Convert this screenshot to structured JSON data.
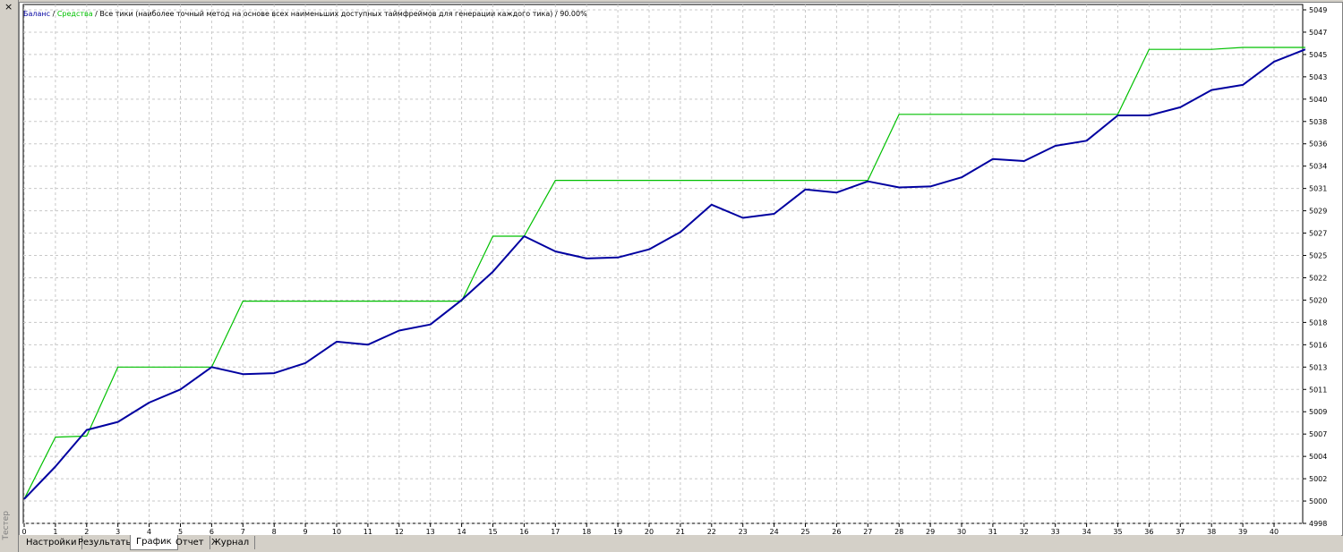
{
  "window": {
    "side_label": "Тестер",
    "close_glyph": "×"
  },
  "legend": {
    "balance_label": "Баланс",
    "equity_label": "Средства",
    "separator": " / ",
    "method_text": "Все тики (наиболее точный метод на основе всех наименьших доступных таймфреймов для генерации каждого тика)",
    "quality_text": "90.00%"
  },
  "tabs": [
    {
      "label": "Настройки",
      "active": false
    },
    {
      "label": "Результаты",
      "active": false
    },
    {
      "label": "График",
      "active": true
    },
    {
      "label": "Отчет",
      "active": false
    },
    {
      "label": "Журнал",
      "active": false
    }
  ],
  "colors": {
    "balance": "#0000a0",
    "equity": "#00c000",
    "grid": "#c8c8c8",
    "text": "#000000"
  },
  "chart_data": {
    "type": "line",
    "xlabel": "",
    "ylabel": "",
    "grid": true,
    "xlim": [
      0,
      41
    ],
    "ylim": [
      4998,
      5049
    ],
    "x_ticks": [
      0,
      1,
      2,
      3,
      4,
      5,
      6,
      7,
      8,
      9,
      10,
      11,
      12,
      13,
      14,
      15,
      16,
      17,
      18,
      19,
      20,
      21,
      22,
      23,
      24,
      25,
      26,
      27,
      28,
      29,
      30,
      31,
      32,
      33,
      34,
      35,
      36,
      37,
      38,
      39,
      40
    ],
    "y_ticks": [
      {
        "label": "5049",
        "value": 5049
      },
      {
        "label": "5047",
        "value": 5047
      },
      {
        "label": "5045",
        "value": 5045
      },
      {
        "label": "5043",
        "value": 5043
      },
      {
        "label": "5040",
        "value": 5040
      },
      {
        "label": "5038",
        "value": 5038
      },
      {
        "label": "5036",
        "value": 5036
      },
      {
        "label": "5034",
        "value": 5034
      },
      {
        "label": "5031",
        "value": 5031
      },
      {
        "label": "5029",
        "value": 5029
      },
      {
        "label": "5027",
        "value": 5027
      },
      {
        "label": "5025",
        "value": 5025
      },
      {
        "label": "5022",
        "value": 5022
      },
      {
        "label": "5020",
        "value": 5020
      },
      {
        "label": "5018",
        "value": 5018
      },
      {
        "label": "5016",
        "value": 5016
      },
      {
        "label": "5013",
        "value": 5013
      },
      {
        "label": "5011",
        "value": 5011
      },
      {
        "label": "5009",
        "value": 5009
      },
      {
        "label": "5007",
        "value": 5007
      },
      {
        "label": "5004",
        "value": 5004
      },
      {
        "label": "5002",
        "value": 5002
      },
      {
        "label": "5000",
        "value": 5000
      },
      {
        "label": "4998",
        "value": 4998
      }
    ],
    "series": [
      {
        "name": "Баланс",
        "x": [
          0,
          1,
          2,
          3,
          4,
          5,
          6,
          7,
          8,
          9,
          10,
          11,
          12,
          13,
          14,
          15,
          16,
          17,
          18,
          19,
          20,
          21,
          22,
          23,
          24,
          25,
          26,
          27,
          28,
          29,
          30,
          31,
          32,
          33,
          34,
          35,
          36,
          37,
          38,
          39,
          40,
          41
        ],
        "values": [
          5000,
          5003.2,
          5006.8,
          5007.6,
          5009.5,
          5010.8,
          5013.0,
          5012.3,
          5012.4,
          5013.4,
          5015.5,
          5015.2,
          5016.6,
          5017.2,
          5019.6,
          5022.4,
          5025.9,
          5024.4,
          5023.7,
          5023.8,
          5024.6,
          5026.3,
          5029.0,
          5027.7,
          5028.1,
          5030.5,
          5030.2,
          5031.3,
          5030.7,
          5030.8,
          5031.7,
          5033.5,
          5033.3,
          5034.8,
          5035.3,
          5037.8,
          5037.8,
          5038.6,
          5040.3,
          5040.8,
          5043.1,
          5044.3
        ]
      },
      {
        "name": "Средства",
        "x": [
          0,
          1,
          2,
          3,
          6,
          7,
          14,
          15,
          16,
          17,
          27,
          28,
          35,
          36,
          38,
          39,
          41
        ],
        "values": [
          5000,
          5006.1,
          5006.2,
          5013.0,
          5013.0,
          5019.5,
          5019.5,
          5025.9,
          5025.9,
          5031.4,
          5031.4,
          5037.9,
          5037.9,
          5044.3,
          5044.3,
          5044.5,
          5044.5
        ]
      }
    ]
  }
}
